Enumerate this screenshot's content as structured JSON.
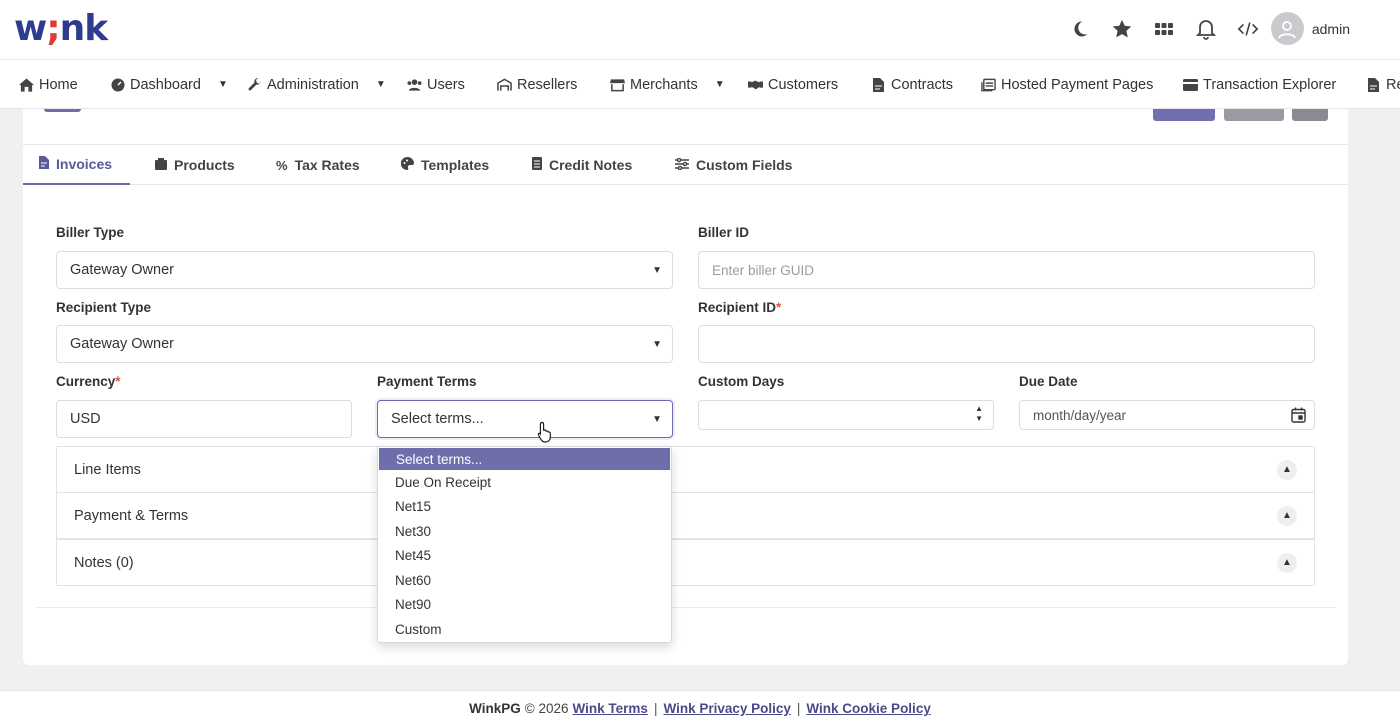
{
  "header": {
    "logo_prefix": "w",
    "logo_semi": ";",
    "logo_suffix": "nk",
    "user_name": "admin",
    "icons": [
      "moon-icon",
      "star-icon",
      "apps-grid-icon",
      "bell-icon",
      "code-icon",
      "user-avatar-icon"
    ]
  },
  "nav": {
    "items": [
      {
        "label": "Home",
        "icon": "home-icon",
        "has_caret": false
      },
      {
        "label": "Dashboard",
        "icon": "dashboard-icon",
        "has_caret": true
      },
      {
        "label": "Administration",
        "icon": "wrench-icon",
        "has_caret": true
      },
      {
        "label": "Users",
        "icon": "users-icon",
        "has_caret": false
      },
      {
        "label": "Resellers",
        "icon": "warehouse-icon",
        "has_caret": false
      },
      {
        "label": "Merchants",
        "icon": "store-icon",
        "has_caret": true
      },
      {
        "label": "Customers",
        "icon": "handshake-icon",
        "has_caret": false
      },
      {
        "label": "Contracts",
        "icon": "file-contract-icon",
        "has_caret": false
      },
      {
        "label": "Hosted Payment Pages",
        "icon": "pages-icon",
        "has_caret": false
      },
      {
        "label": "Transaction Explorer",
        "icon": "credit-card-icon",
        "has_caret": false
      },
      {
        "label": "Rep",
        "icon": "report-icon",
        "has_caret": false
      }
    ]
  },
  "tabs": [
    {
      "label": "Invoices",
      "icon": "file-invoice-icon",
      "active": true
    },
    {
      "label": "Products",
      "icon": "box-icon",
      "active": false
    },
    {
      "label": "Tax Rates",
      "icon": "percent-icon",
      "active": false
    },
    {
      "label": "Templates",
      "icon": "palette-icon",
      "active": false
    },
    {
      "label": "Credit Notes",
      "icon": "note-icon",
      "active": false
    },
    {
      "label": "Custom Fields",
      "icon": "sliders-icon",
      "active": false
    }
  ],
  "form": {
    "biller_type": {
      "label": "Biller Type",
      "value": "Gateway Owner"
    },
    "biller_id": {
      "label": "Biller ID",
      "placeholder": "Enter biller GUID"
    },
    "recipient_type": {
      "label": "Recipient Type",
      "value": "Gateway Owner"
    },
    "recipient_id": {
      "label": "Recipient ID",
      "required_mark": "*",
      "value": ""
    },
    "currency": {
      "label": "Currency",
      "required_mark": "*",
      "value": "USD"
    },
    "payment_terms": {
      "label": "Payment Terms",
      "value": "Select terms..."
    },
    "custom_days": {
      "label": "Custom Days",
      "value": ""
    },
    "due_date": {
      "label": "Due Date",
      "placeholder": "month/day/year"
    }
  },
  "accordions": [
    {
      "label": "Line Items"
    },
    {
      "label": "Payment & Terms"
    },
    {
      "label": "Notes (0)"
    }
  ],
  "dropdown": {
    "options": [
      "Select terms...",
      "Due On Receipt",
      "Net15",
      "Net30",
      "Net45",
      "Net60",
      "Net90",
      "Custom"
    ],
    "selected_index": 0
  },
  "footer": {
    "brand": "WinkPG",
    "copyright": "© 2026",
    "links": [
      "Wink Terms",
      "Wink Privacy Policy",
      "Wink Cookie Policy"
    ],
    "separator": "|"
  },
  "colors": {
    "accent": "#6e6eab",
    "logo": "#2f3b8f",
    "required": "#d9534f"
  }
}
